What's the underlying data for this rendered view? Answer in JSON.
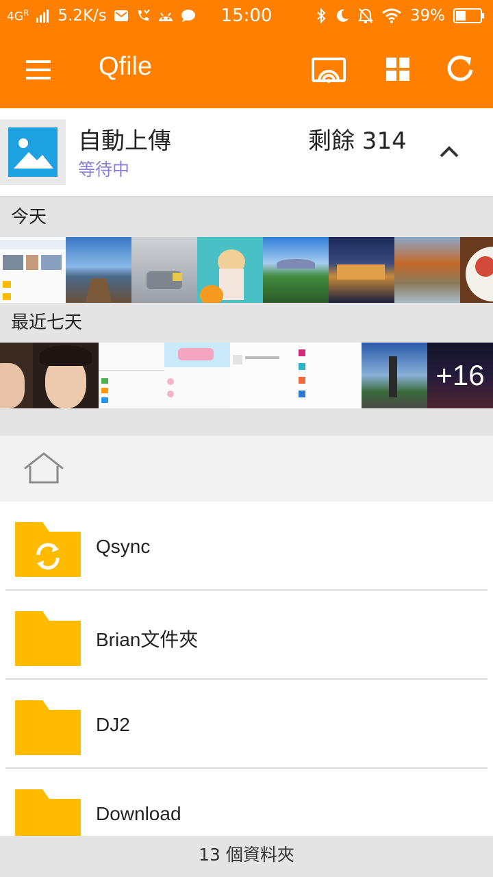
{
  "status_bar": {
    "network": "4G",
    "roaming": "R",
    "speed": "5.2K/s",
    "time": "15:00",
    "battery": "39%",
    "icons": [
      "mail-icon",
      "missed-call-icon",
      "android-icon",
      "chat-icon",
      "bluetooth-icon",
      "moon-icon",
      "alarm-off-icon",
      "wifi-icon",
      "battery-icon"
    ]
  },
  "toolbar": {
    "title": "Qfile",
    "icons": [
      "menu-icon",
      "cast-icon",
      "grid-view-icon",
      "refresh-icon"
    ]
  },
  "auto_upload": {
    "title": "自動上傳",
    "status": "等待中",
    "remaining": "剩餘 314",
    "icon": "image-icon"
  },
  "sections": {
    "today": "今天",
    "last7": "最近七天",
    "more_count": "+16"
  },
  "folders": [
    {
      "name": "Qsync",
      "icon": "sync-folder-icon"
    },
    {
      "name": "Brian文件夾",
      "icon": "folder-icon"
    },
    {
      "name": "DJ2",
      "icon": "folder-icon"
    },
    {
      "name": "Download",
      "icon": "folder-icon"
    }
  ],
  "footer": {
    "summary": "13 個資料夾"
  },
  "colors": {
    "brand": "#ff7f00",
    "folder": "#ffbb00",
    "pending": "#8c7fd4",
    "upload_tile": "#1ea1e1"
  }
}
